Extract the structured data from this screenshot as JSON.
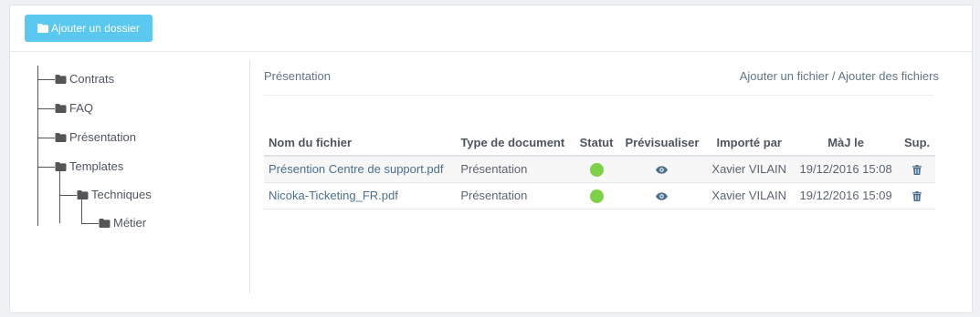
{
  "toolbar": {
    "add_folder_label": "Ajouter un dossier",
    "add_folder_icon": "folder-icon"
  },
  "tree": {
    "items": [
      {
        "label": "Contrats",
        "icon": "folder-icon"
      },
      {
        "label": "FAQ",
        "icon": "folder-icon"
      },
      {
        "label": "Présentation",
        "icon": "folder-icon"
      },
      {
        "label": "Templates",
        "icon": "folder-icon"
      },
      {
        "label": "Techniques",
        "icon": "folder-icon"
      },
      {
        "label": "Métier",
        "icon": "folder-icon"
      }
    ]
  },
  "content": {
    "breadcrumb": "Présentation",
    "add_file": "Ajouter un fichier",
    "separator": " / ",
    "add_files": "Ajouter des fichiers"
  },
  "table": {
    "headers": [
      "Nom du fichier",
      "Type de document",
      "Statut",
      "Prévisualiser",
      "Importé par",
      "MàJ le",
      "Sup."
    ],
    "rows": [
      {
        "name": "Présention Centre de support.pdf",
        "type": "Présentation",
        "status": "active",
        "preview_icon": "eye-icon",
        "imported_by": "Xavier VILAIN",
        "updated": "19/12/2016 15:08",
        "delete_icon": "trash-icon"
      },
      {
        "name": "Nicoka-Ticketing_FR.pdf",
        "type": "Présentation",
        "status": "active",
        "preview_icon": "eye-icon",
        "imported_by": "Xavier VILAIN",
        "updated": "19/12/2016 15:09",
        "delete_icon": "trash-icon"
      }
    ]
  },
  "colors": {
    "button_bg": "#5bc8f0",
    "status_green": "#7ed04a",
    "link": "#4a6f8c",
    "folder_icon": "#555555"
  }
}
